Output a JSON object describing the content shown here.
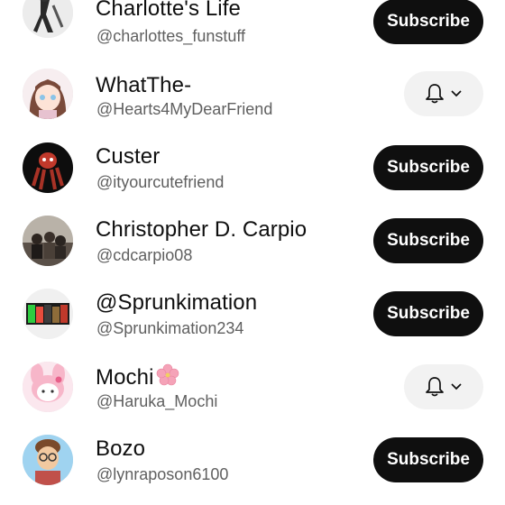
{
  "subscriptions": [
    {
      "name": "Charlotte's Life",
      "handle": "@charlottes_funstuff",
      "action": "Subscribe",
      "avatar_icon": "charlotte-avatar-icon"
    },
    {
      "name": "WhatThe-",
      "handle": "@Hearts4MyDearFriend",
      "action": "bell",
      "avatar_icon": "anime-girl-avatar-icon"
    },
    {
      "name": "Custer",
      "handle": "@ityourcutefriend",
      "action": "Subscribe",
      "avatar_icon": "red-creature-avatar-icon"
    },
    {
      "name": "Christopher D. Carpio",
      "handle": "@cdcarpio08",
      "action": "Subscribe",
      "avatar_icon": "group-photo-avatar-icon"
    },
    {
      "name": "@Sprunkimation",
      "handle": "@Sprunkimation234",
      "action": "Subscribe",
      "avatar_icon": "sprunki-avatar-icon"
    },
    {
      "name": "Mochi",
      "handle": "@Haruka_Mochi",
      "action": "bell",
      "avatar_icon": "my-melody-avatar-icon",
      "name_emoji": "cherry-blossom-icon"
    },
    {
      "name": "Bozo",
      "handle": "@lynraposon6100",
      "action": "Subscribe",
      "avatar_icon": "cartoon-boy-avatar-icon"
    }
  ],
  "colors": {
    "subscribe_bg": "#0f0f0f",
    "bell_bg": "#f2f2f2",
    "name_text": "#0f0f0f",
    "handle_text": "#606060"
  }
}
